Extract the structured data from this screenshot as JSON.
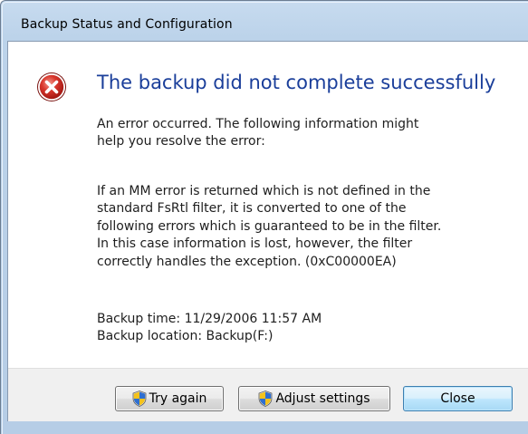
{
  "window": {
    "title": "Backup Status and Configuration"
  },
  "dialog": {
    "icon": "error-icon",
    "heading": "The backup did not complete successfully",
    "intro_lines": [
      "An error occurred. The following information might",
      "help you resolve the error:"
    ],
    "detail_lines": [
      "If an MM error is returned which is not defined in the",
      "standard FsRtl filter, it is converted to one of the",
      "following errors which is guaranteed to be in the filter.",
      "In this case information is lost, however, the filter",
      "correctly handles the exception. (0xC00000EA)"
    ],
    "info_lines": [
      "Backup time: 11/29/2006 11:57 AM",
      "Backup location: Backup(F:)"
    ]
  },
  "buttons": {
    "try_again": {
      "label": "Try again",
      "icon": "uac-shield-icon"
    },
    "adjust_settings": {
      "label": "Adjust settings",
      "icon": "uac-shield-icon"
    },
    "close": {
      "label": "Close"
    }
  },
  "colors": {
    "heading": "#1a3e9a",
    "error_red": "#d8312b",
    "frame": "#bcd3ea"
  }
}
